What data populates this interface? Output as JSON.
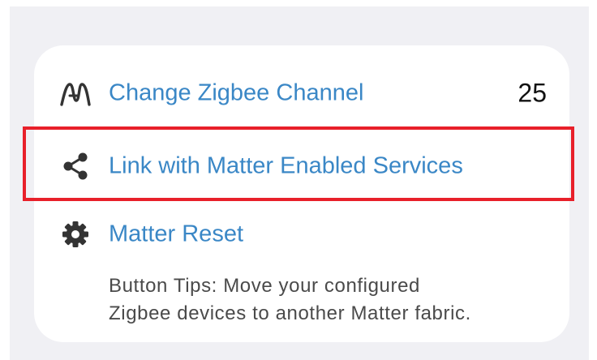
{
  "settings": {
    "items": [
      {
        "label": "Change Zigbee Channel",
        "value": "25",
        "icon": "zigbee-icon"
      },
      {
        "label": "Link with Matter Enabled Services",
        "icon": "share-icon"
      },
      {
        "label": "Matter Reset",
        "icon": "gear-icon"
      }
    ],
    "tips_line_1": "Button Tips: Move your configured",
    "tips_line_2": "Zigbee devices to another Matter fabric."
  },
  "colors": {
    "link": "#3a87c6",
    "highlight": "#e8202a",
    "background": "#f0f0f4"
  }
}
